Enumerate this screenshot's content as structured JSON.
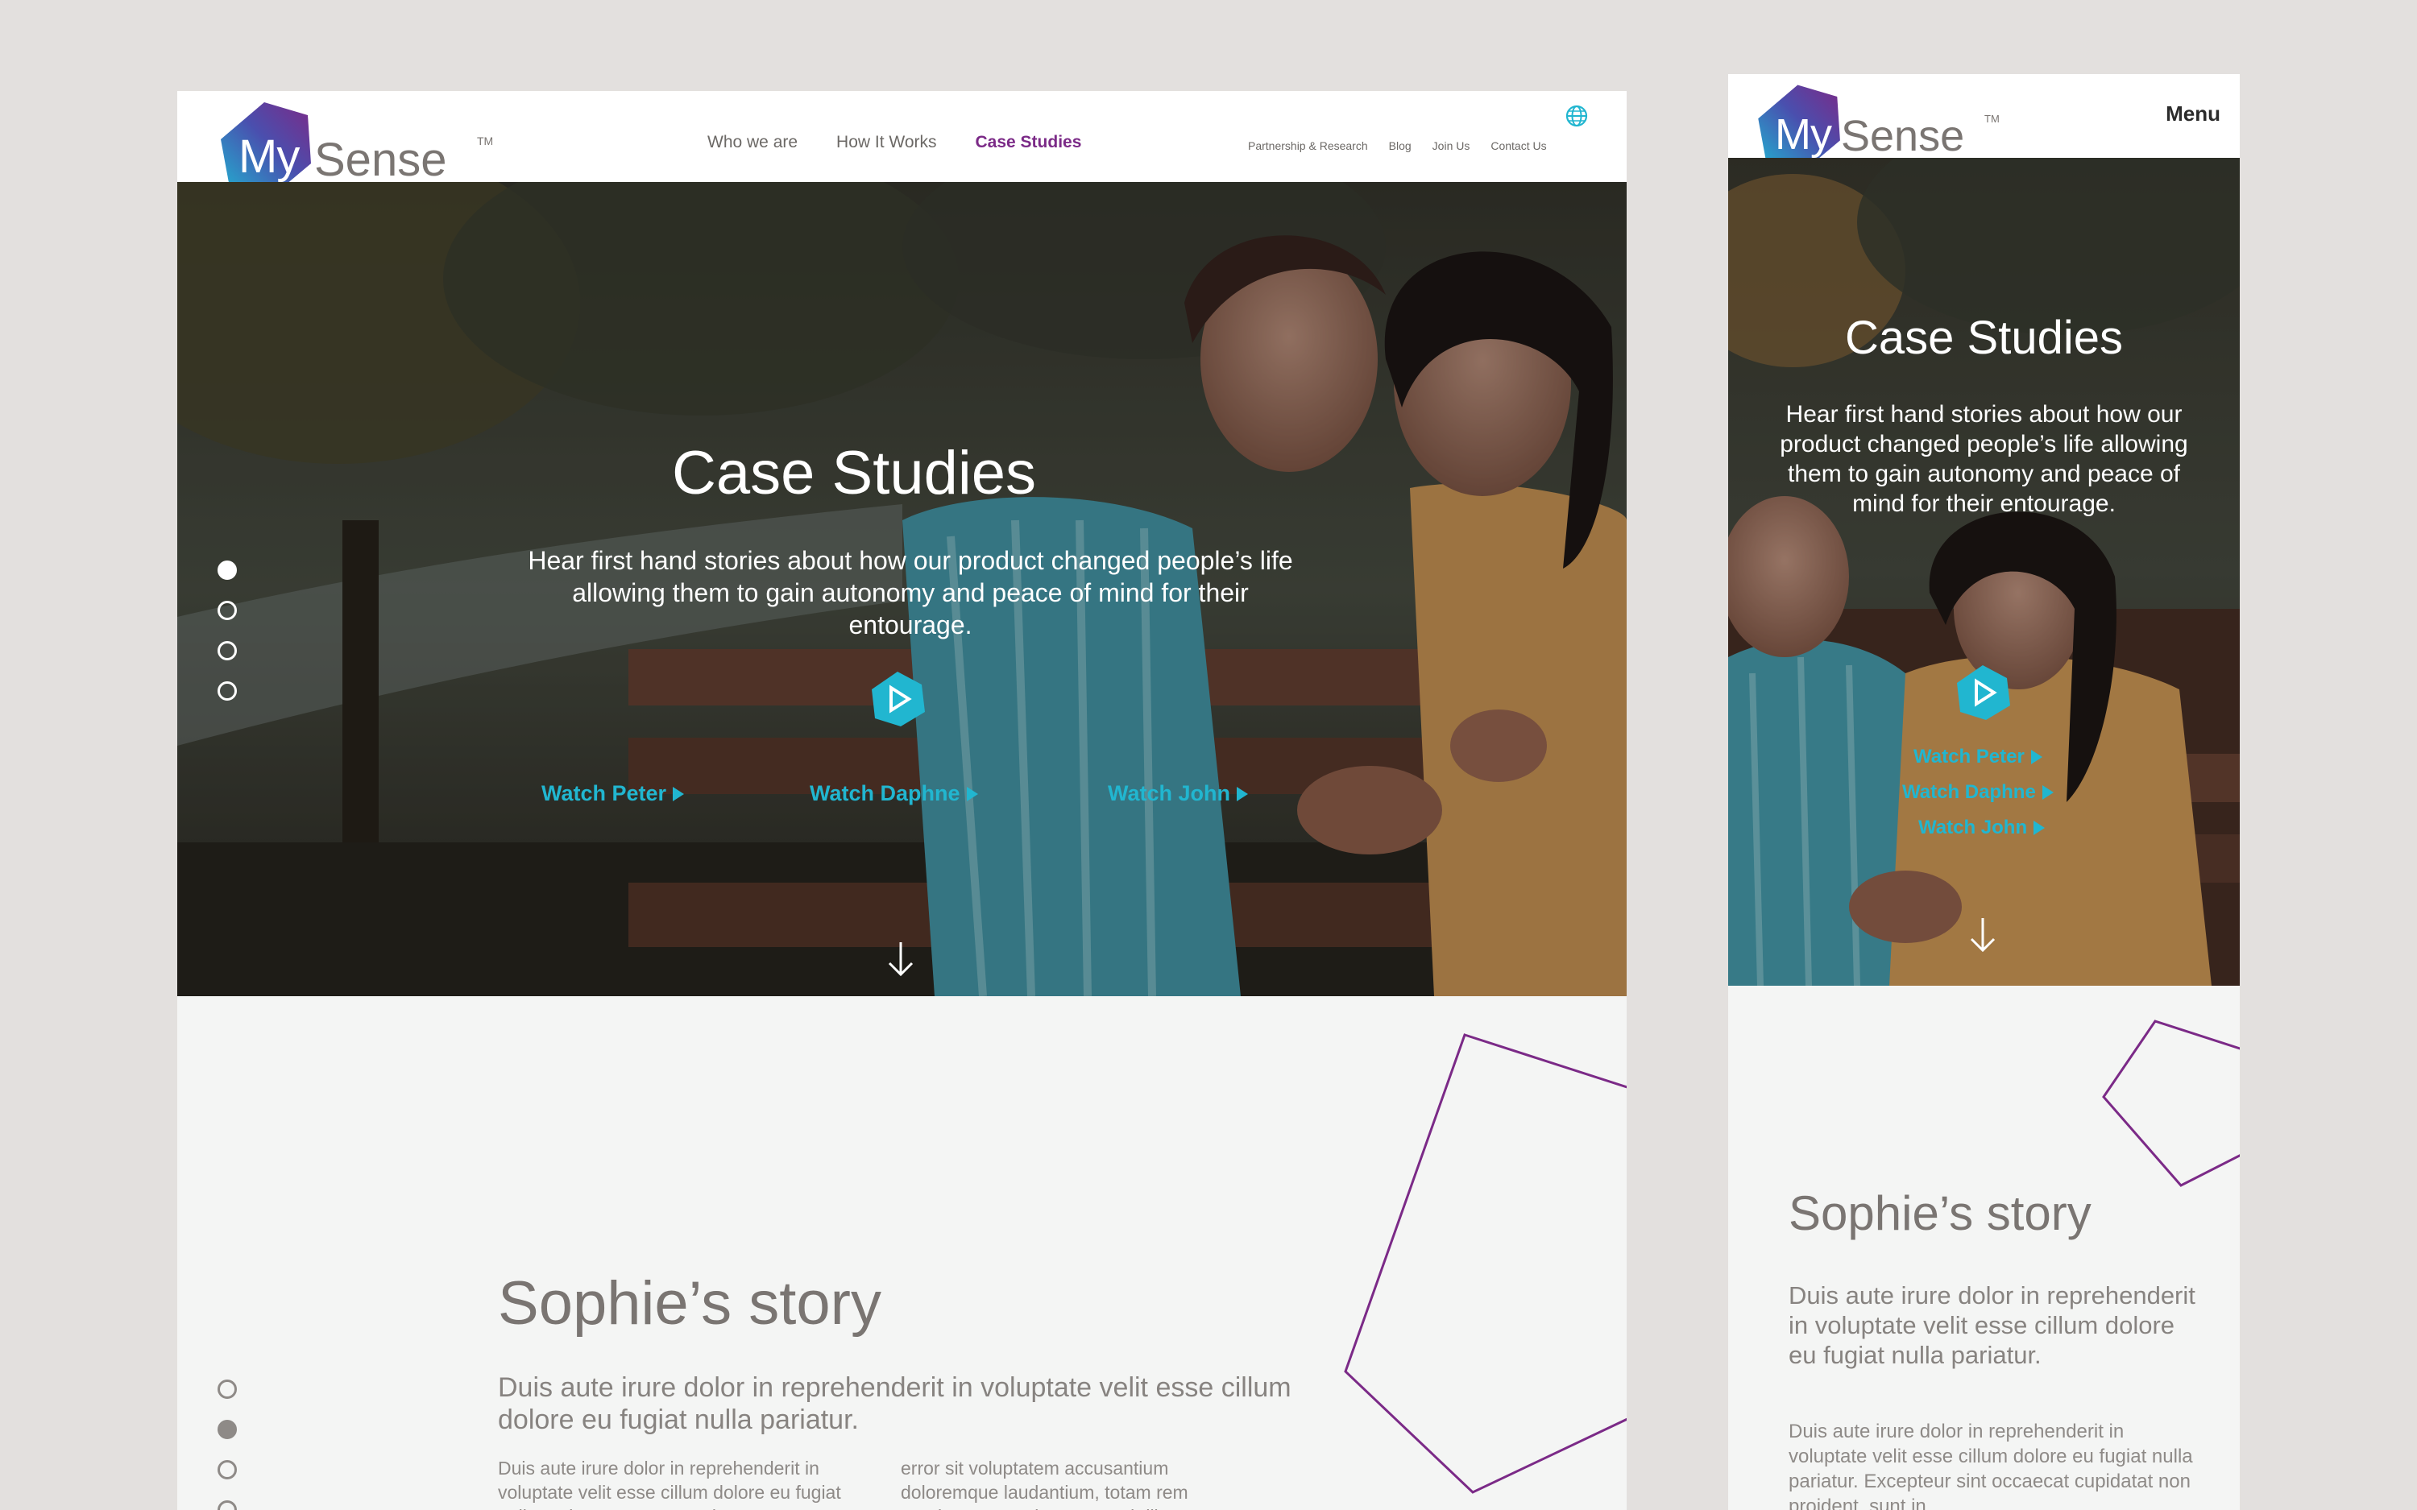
{
  "colors": {
    "accent_purple": "#7b2a87",
    "accent_teal": "#21b6d0",
    "text_gray": "#7a7572",
    "page_bg": "#e3e0de"
  },
  "brand": {
    "logo_my": "My",
    "logo_sense": "Sense",
    "logo_tm": "TM"
  },
  "desktop": {
    "nav_main": [
      "Who we are",
      "How It Works",
      "Case Studies"
    ],
    "nav_utility": [
      "Partnership & Research",
      "Blog",
      "Join Us",
      "Contact Us"
    ],
    "hero": {
      "title": "Case Studies",
      "subtitle": "Hear first hand stories about how our product changed people’s life allowing them to gain autonomy and peace of mind for their entourage.",
      "watch_links": [
        "Watch Peter",
        "Watch Daphne",
        "Watch John"
      ]
    },
    "story": {
      "title": "Sophie’s story",
      "lead": "Duis aute irure dolor in reprehenderit in voluptate velit esse cillum dolore eu fugiat nulla pariatur.",
      "body_col1": "Duis aute irure dolor in reprehenderit in voluptate velit esse cillum dolore eu fugiat nulla pariatur. Excepteur sint",
      "body_col2": "error sit voluptatem accusantium doloremque laudantium, totam rem aperiam, eaque ipsa quae ab illo"
    }
  },
  "mobile": {
    "menu_label": "Menu",
    "hero": {
      "title": "Case Studies",
      "subtitle": "Hear first hand stories about how our product changed people’s life allowing them to gain autonomy and peace of mind for their entourage.",
      "watch_links": [
        "Watch Peter",
        "Watch Daphne",
        "Watch John"
      ]
    },
    "story": {
      "title": "Sophie’s story",
      "lead": "Duis aute irure dolor in reprehenderit in voluptate velit esse cillum dolore eu fugiat nulla pariatur.",
      "body": "Duis aute irure dolor in reprehenderit in voluptate velit esse cillum dolore eu fugiat nulla pariatur. Excepteur sint occaecat cupidatat non proident, sunt in"
    }
  }
}
